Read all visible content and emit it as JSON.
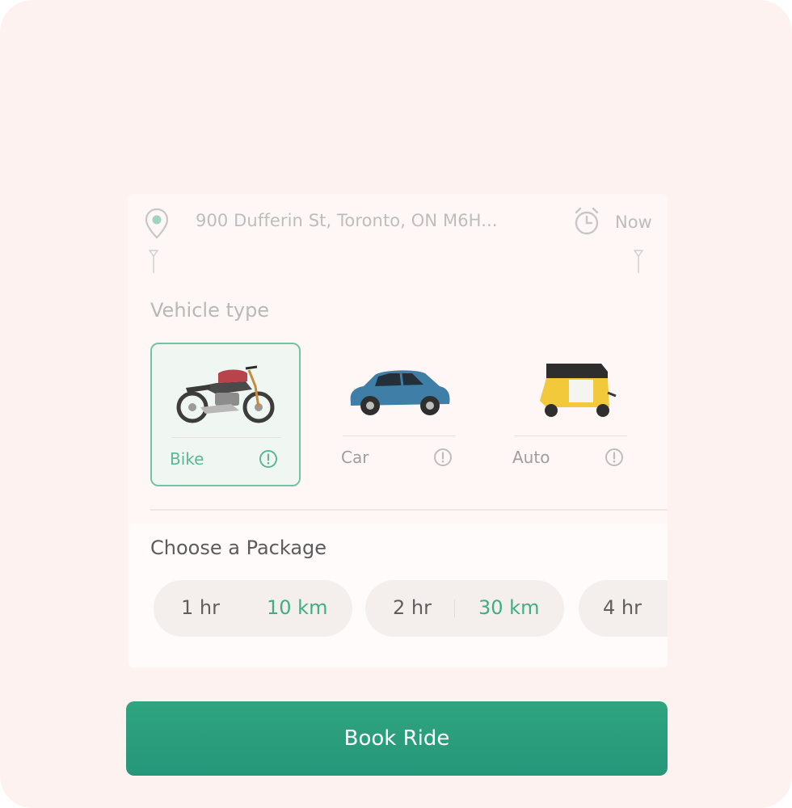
{
  "location": {
    "address": "900 Dufferin St, Toronto, ON M6H...",
    "time": "Now",
    "pin_icon": "location-pin-icon",
    "clock_icon": "alarm-clock-icon"
  },
  "vehicle_section": {
    "title": "Vehicle type",
    "items": [
      {
        "label": "Bike",
        "icon": "motorcycle-icon",
        "selected": true
      },
      {
        "label": "Car",
        "icon": "car-icon",
        "selected": false
      },
      {
        "label": "Auto",
        "icon": "auto-rickshaw-icon",
        "selected": false
      }
    ]
  },
  "package_section": {
    "title": "Choose a Package",
    "items": [
      {
        "hours": "1 hr",
        "distance": "10 km"
      },
      {
        "hours": "2 hr",
        "distance": "30 km"
      },
      {
        "hours": "4 hr",
        "distance": ""
      }
    ]
  },
  "book_button": {
    "label": "Book Ride"
  },
  "colors": {
    "accent": "#2fa57f",
    "selected_border": "#6fc6a4",
    "background": "#fdf2ef"
  }
}
